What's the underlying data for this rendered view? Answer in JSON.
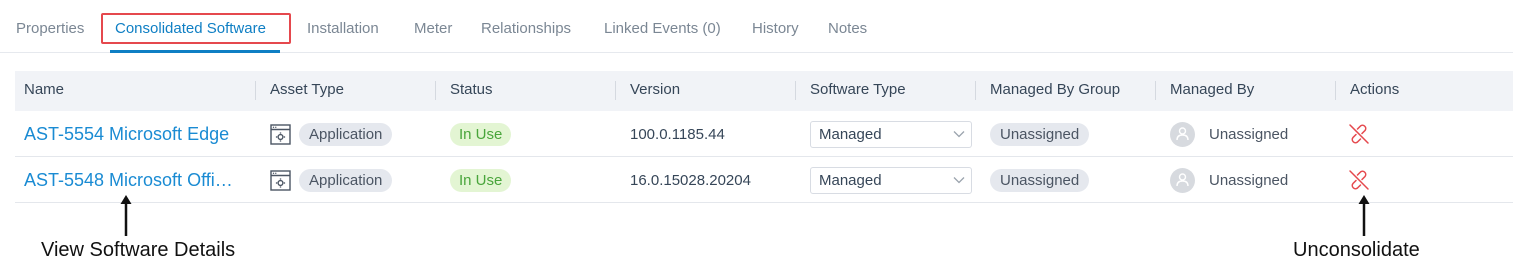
{
  "tabs": [
    {
      "label": "Properties",
      "active": false
    },
    {
      "label": "Consolidated Software",
      "active": true
    },
    {
      "label": "Installation",
      "active": false
    },
    {
      "label": "Meter",
      "active": false
    },
    {
      "label": "Relationships",
      "active": false
    },
    {
      "label": "Linked Events (0)",
      "active": false
    },
    {
      "label": "History",
      "active": false
    },
    {
      "label": "Notes",
      "active": false
    }
  ],
  "table": {
    "columns": [
      "Name",
      "Asset Type",
      "Status",
      "Version",
      "Software Type",
      "Managed By Group",
      "Managed By",
      "Actions"
    ],
    "rows": [
      {
        "name": "AST-5554 Microsoft Edge",
        "asset_type": "Application",
        "asset_type_icon": "application-icon",
        "status": "In Use",
        "version": "100.0.1185.44",
        "software_type": "Managed",
        "managed_by_group": "Unassigned",
        "managed_by": "Unassigned",
        "action_icon": "unlink-icon"
      },
      {
        "name": "AST-5548 Microsoft Offi…",
        "asset_type": "Application",
        "asset_type_icon": "application-icon",
        "status": "In Use",
        "version": "16.0.15028.20204",
        "software_type": "Managed",
        "managed_by_group": "Unassigned",
        "managed_by": "Unassigned",
        "action_icon": "unlink-icon"
      }
    ]
  },
  "annotations": {
    "view_details": "View Software Details",
    "unconsolidate": "Unconsolidate"
  },
  "colors": {
    "accent": "#0f7fc4",
    "link": "#1a8bd3",
    "highlight_border": "#e5484d",
    "status_bg": "#e3f5d3",
    "status_text": "#49a53b",
    "action_icon": "#e5484d"
  }
}
